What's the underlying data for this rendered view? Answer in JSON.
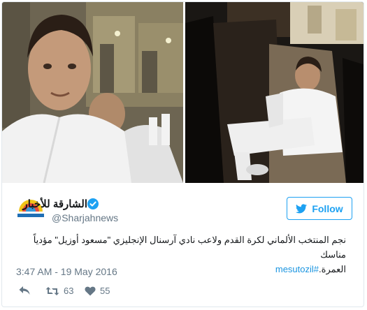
{
  "photos": {
    "left": "selfie-in-ihram-at-mosque",
    "right": "man-in-white-seated-in-car"
  },
  "account": {
    "name": "الشارقة للأخبار",
    "handle": "@Sharjahnews",
    "verified": true
  },
  "follow_button": {
    "label": "Follow",
    "icon": "twitter-bird-icon"
  },
  "tweet": {
    "line1": "نجم المنتخب الألماني لكرة القدم ولاعب نادي آرسنال الإنجليزي \"مسعود أوزيل\" مؤدياً مناسك",
    "line2_text": "العمرة.",
    "hashtag": "#mesutozil",
    "timestamp": "3:47 AM - 19 May 2016"
  },
  "actions": {
    "reply_icon": "reply-icon",
    "retweet_icon": "retweet-icon",
    "retweet_count": "63",
    "like_icon": "heart-icon",
    "like_count": "55"
  },
  "colors": {
    "accent": "#1da1f2",
    "hashtag": "#1b95e0",
    "muted": "#657786",
    "text": "#14171a",
    "border": "#e1e8ed"
  }
}
